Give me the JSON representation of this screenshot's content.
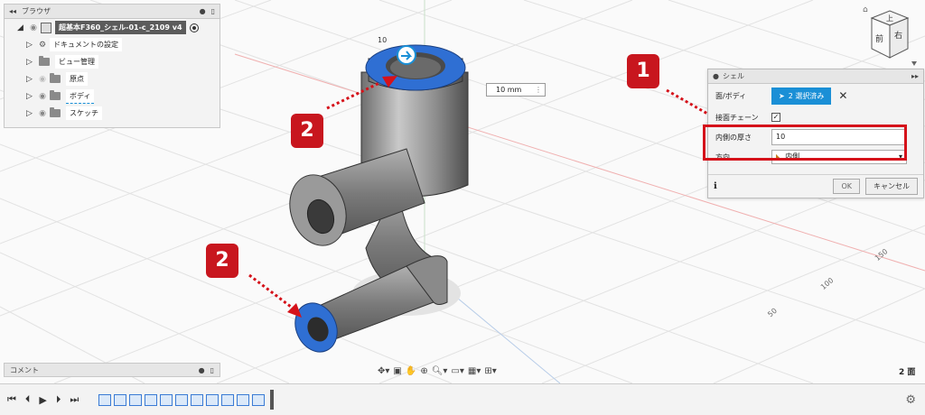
{
  "browser": {
    "title": "ブラウザ",
    "root": "超基本F360_シェル-01-c_2109 v4",
    "items": [
      {
        "label": "ドキュメントの設定"
      },
      {
        "label": "ビュー管理"
      },
      {
        "label": "原点"
      },
      {
        "label": "ボディ"
      },
      {
        "label": "スケッチ"
      }
    ]
  },
  "viewcube": {
    "top": "上",
    "front": "前",
    "right": "右"
  },
  "dialog": {
    "title": "シェル",
    "face_body_label": "面/ボディ",
    "selection_text": "2 選択済み",
    "tangent_chain_label": "接面チェーン",
    "inner_thickness_label": "内側の厚さ",
    "inner_thickness_value": "10",
    "direction_label": "方向",
    "direction_value": "内側",
    "ok_label": "OK",
    "cancel_label": "キャンセル"
  },
  "canvas": {
    "dimension_value": "10 mm",
    "ring_dim_label": "10",
    "status_faces": "2 面",
    "axis_ticks": [
      "150",
      "100",
      "50"
    ]
  },
  "annotations": {
    "badge1": "1",
    "badge2a": "2",
    "badge2b": "2"
  },
  "comments": {
    "label": "コメント"
  },
  "colors": {
    "accent": "#1a8fd6",
    "callout": "#d5121a",
    "selected_face": "#2f6fd3"
  }
}
